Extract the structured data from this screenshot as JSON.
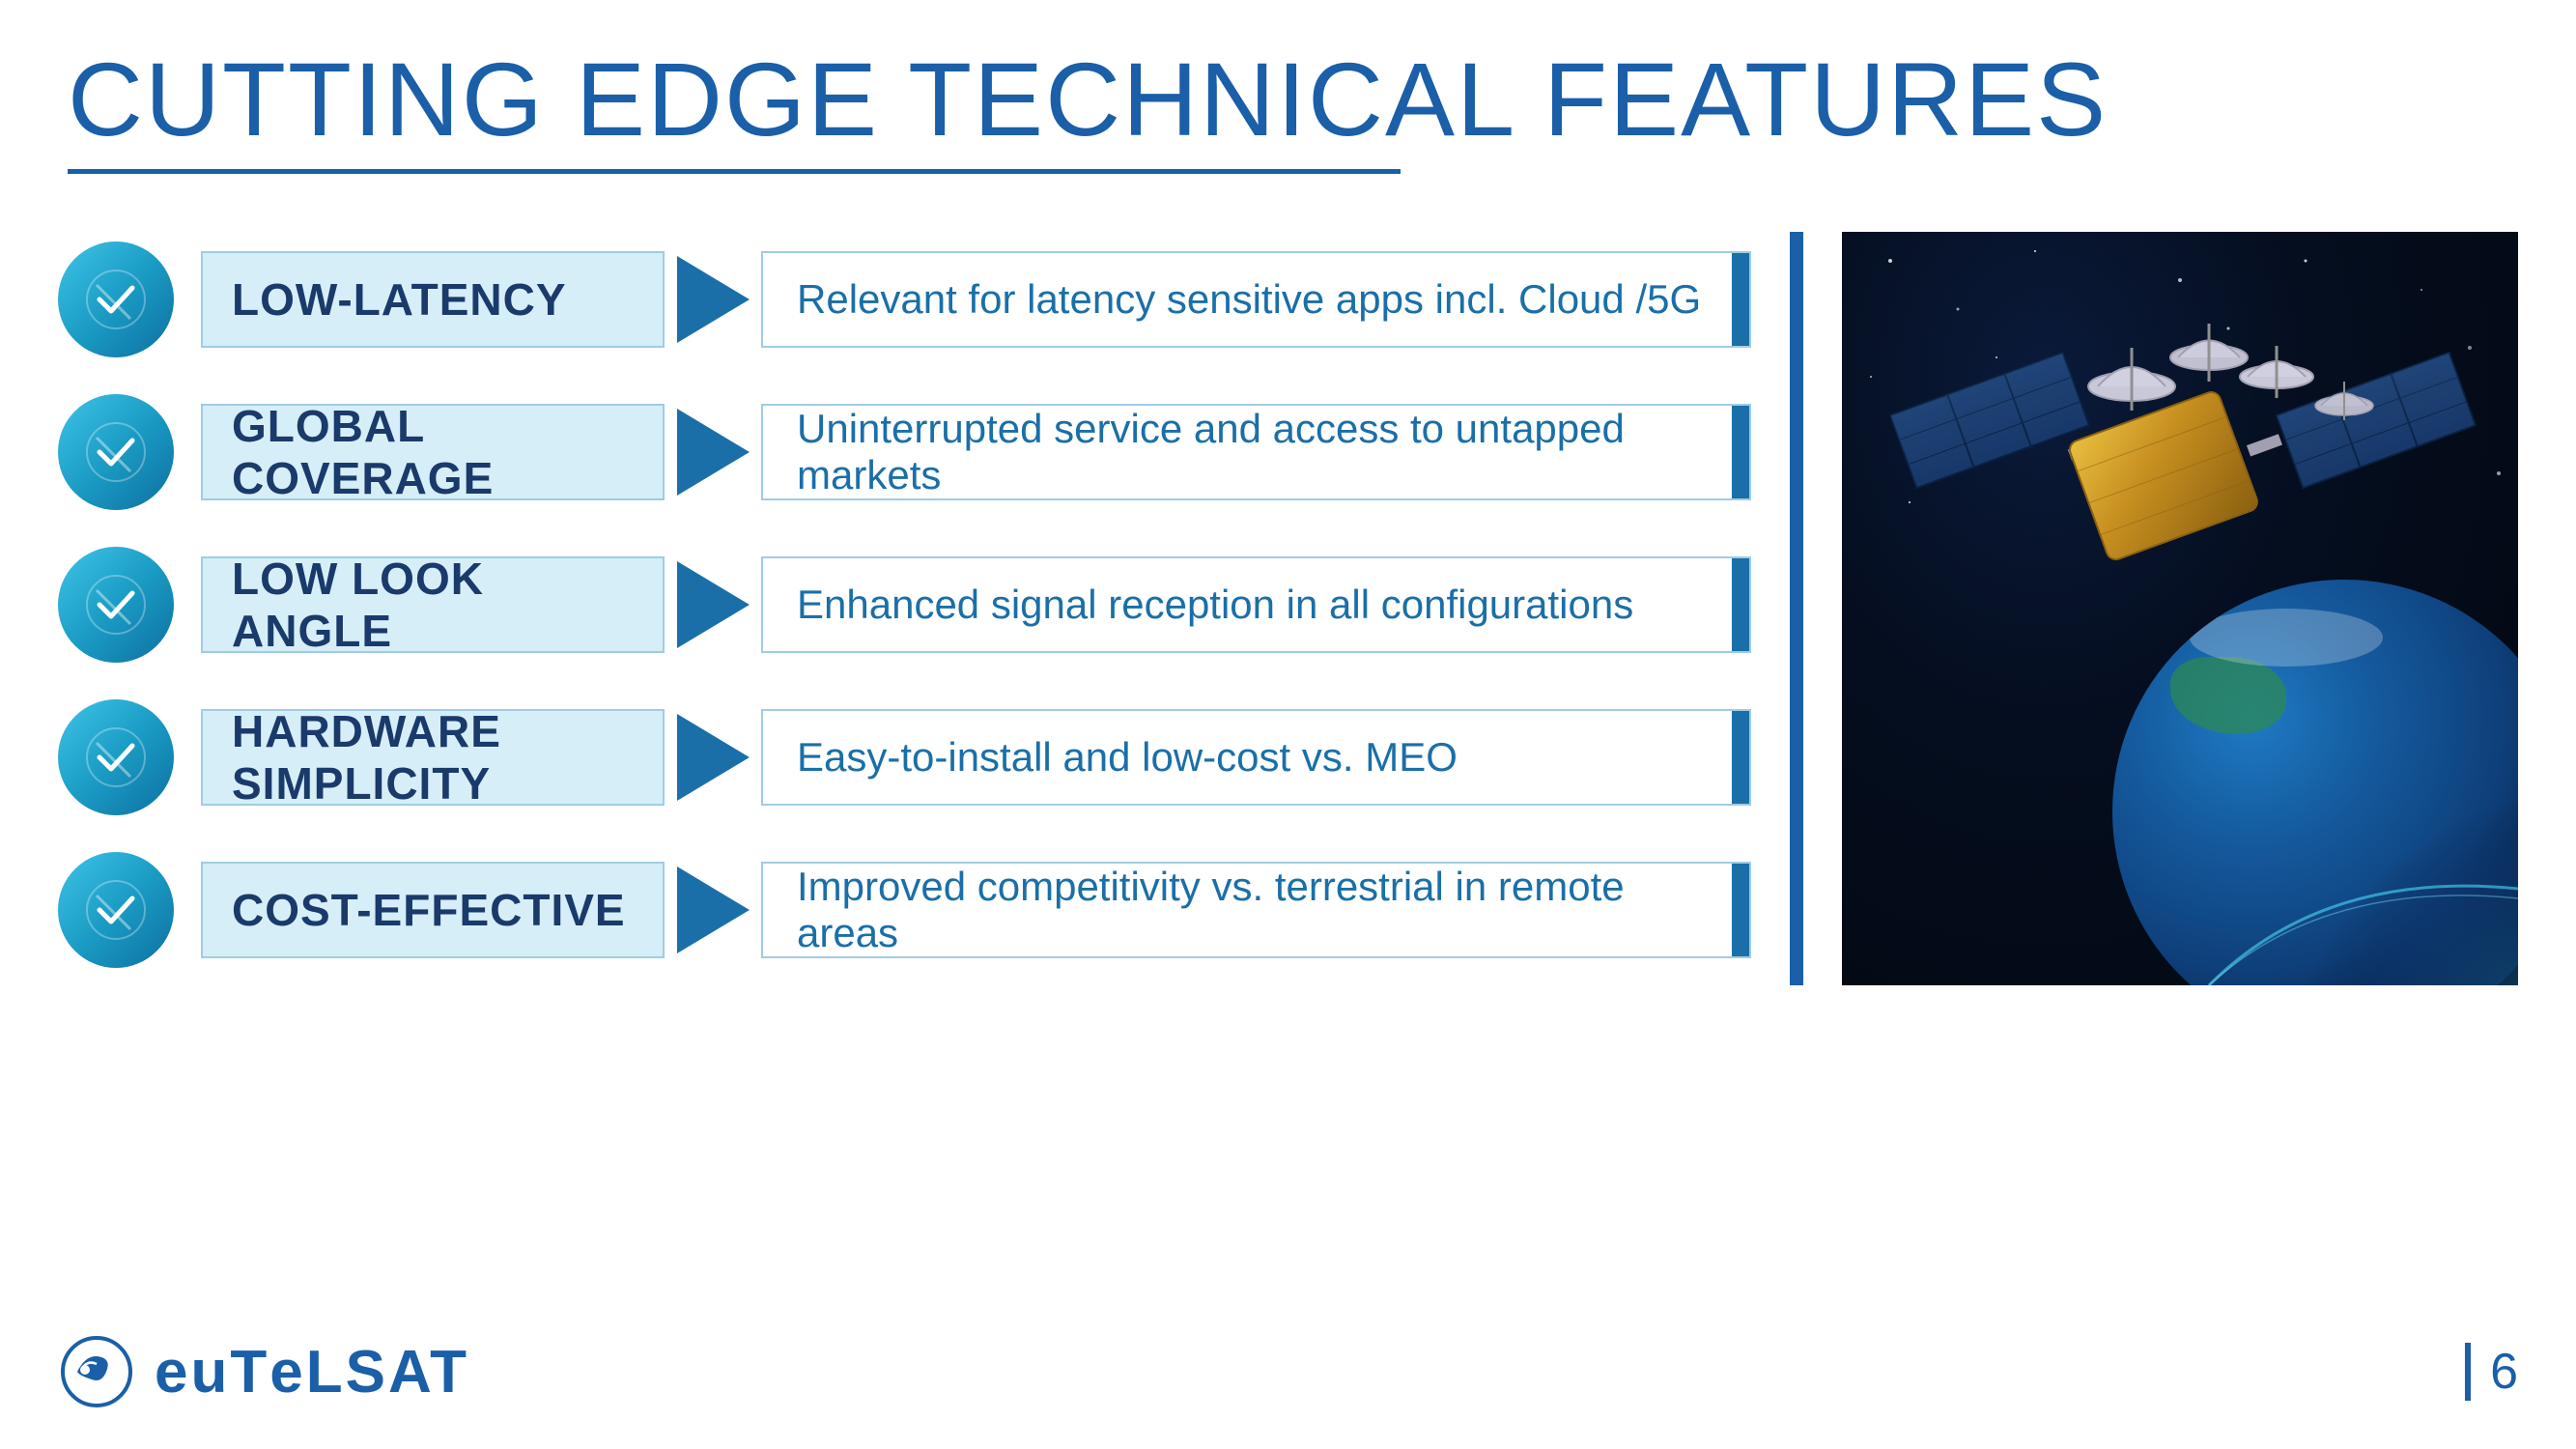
{
  "page": {
    "title": "CUTTING EDGE TECHNICAL FEATURES",
    "page_number": "6"
  },
  "features": [
    {
      "id": "low-latency",
      "label": "LOW-LATENCY",
      "description": "Relevant for latency sensitive apps incl. Cloud /5G"
    },
    {
      "id": "global-coverage",
      "label": "GLOBAL COVERAGE",
      "description": "Uninterrupted service and access to untapped markets"
    },
    {
      "id": "low-look-angle",
      "label": "LOW LOOK ANGLE",
      "description": "Enhanced signal reception in all configurations"
    },
    {
      "id": "hardware-simplicity",
      "label": "HARDWARE SIMPLICITY",
      "description": "Easy-to-install and low-cost vs. MEO"
    },
    {
      "id": "cost-effective",
      "label": "COST-EFFECTIVE",
      "description": "Improved competitivity vs. terrestrial in remote areas"
    }
  ],
  "logo": {
    "text": "eutelsat",
    "display": "euTeLSAT"
  },
  "colors": {
    "primary_blue": "#1a5fa8",
    "light_blue": "#1a6fa8",
    "cyan_circle": "#40c4e8",
    "label_bg": "#d6eef7",
    "separator": "#1a5fa8"
  }
}
